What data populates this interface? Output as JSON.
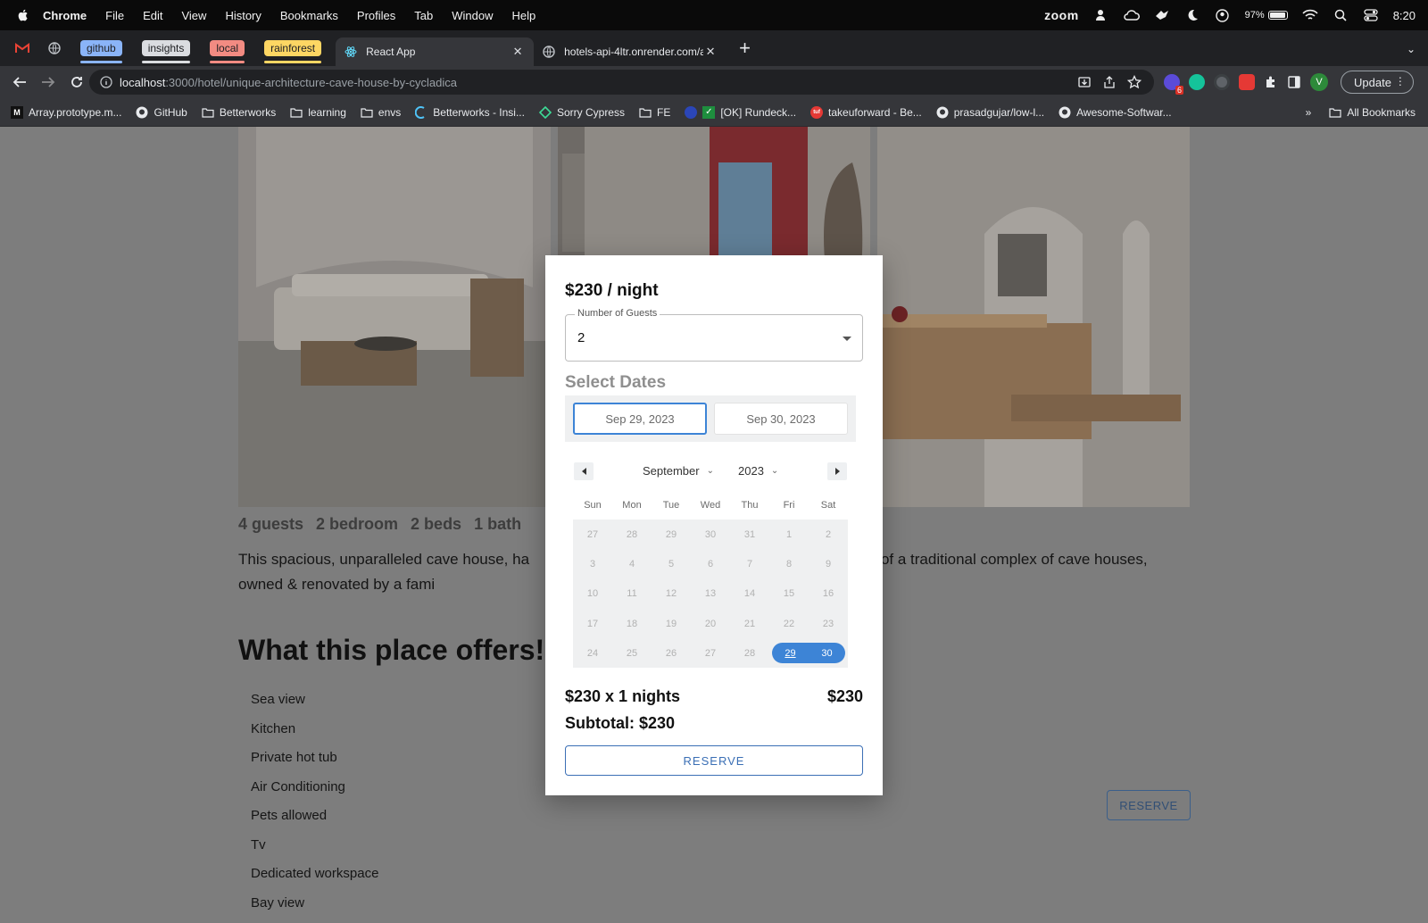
{
  "os_menubar": {
    "app": "Chrome",
    "menus": [
      "File",
      "Edit",
      "View",
      "History",
      "Bookmarks",
      "Profiles",
      "Tab",
      "Window",
      "Help"
    ],
    "zoom_label": "zoom",
    "battery": "97%",
    "time": "8:20"
  },
  "tabs": {
    "groups": [
      {
        "label": "github",
        "color": "#8ab4f8"
      },
      {
        "label": "insights",
        "color": "#dadce0"
      },
      {
        "label": "local",
        "color": "#f28b82"
      },
      {
        "label": "rainforest",
        "color": "#fdd663"
      }
    ],
    "active": {
      "title": "React App",
      "icon": "react-icon"
    },
    "inactive": {
      "title": "hotels-api-4ltr.onrender.com/a",
      "icon": "globe-icon"
    }
  },
  "toolbar": {
    "url_host": "localhost",
    "url_path": ":3000/hotel/unique-architecture-cave-house-by-cycladica",
    "update_label": "Update",
    "profile_initial": "V",
    "ext_badge": "6"
  },
  "bookmarks": {
    "items": [
      {
        "label": "Array.prototype.m...",
        "icon": "mdn-icon"
      },
      {
        "label": "GitHub",
        "icon": "github-icon"
      },
      {
        "label": "Betterworks",
        "icon": "folder-icon"
      },
      {
        "label": "learning",
        "icon": "folder-icon"
      },
      {
        "label": "envs",
        "icon": "folder-icon"
      },
      {
        "label": "Betterworks - Insi...",
        "icon": "betterworks-icon"
      },
      {
        "label": "Sorry Cypress",
        "icon": "cypress-icon"
      },
      {
        "label": "FE",
        "icon": "folder-icon"
      },
      {
        "label": "[OK] Rundeck...",
        "icon": "rundeck-icon"
      },
      {
        "label": "takeuforward - Be...",
        "icon": "tuf-icon"
      },
      {
        "label": "prasadgujar/low-l...",
        "icon": "github-icon"
      },
      {
        "label": "Awesome-Softwar...",
        "icon": "github-icon"
      }
    ],
    "more": "»",
    "all_label": "All Bookmarks"
  },
  "listing": {
    "specs": [
      "4 guests",
      "2 bedroom",
      "2 beds",
      "1 bath"
    ],
    "description": "This spacious, unparalleled cave house, ha                                                               f Oia, is part of a traditional complex of cave houses, owned & renovated by a fami",
    "offers_title": "What this place offers!",
    "amenities": [
      "Sea view",
      "Kitchen",
      "Private hot tub",
      "Air Conditioning",
      "Pets allowed",
      "Tv",
      "Dedicated workspace",
      "Bay view"
    ],
    "reserve_label": "RESERVE"
  },
  "booking": {
    "price": "$230 / night",
    "guests_label": "Number of Guests",
    "guests_value": "2",
    "select_dates": "Select Dates",
    "start_date": "Sep 29, 2023",
    "end_date": "Sep 30, 2023",
    "month": "September",
    "year": "2023",
    "weekdays": [
      "Sun",
      "Mon",
      "Tue",
      "Wed",
      "Thu",
      "Fri",
      "Sat"
    ],
    "days": [
      "27",
      "28",
      "29",
      "30",
      "31",
      "1",
      "2",
      "3",
      "4",
      "5",
      "6",
      "7",
      "8",
      "9",
      "10",
      "11",
      "12",
      "13",
      "14",
      "15",
      "16",
      "17",
      "18",
      "19",
      "20",
      "21",
      "22",
      "23",
      "24",
      "25",
      "26",
      "27",
      "28",
      "29",
      "30"
    ],
    "selected_range": [
      "29",
      "30"
    ],
    "calc": "$230 x 1 nights",
    "calc_total": "$230",
    "subtotal": "Subtotal: $230",
    "reserve_label": "RESERVE",
    "accent": "#3d84d6"
  }
}
